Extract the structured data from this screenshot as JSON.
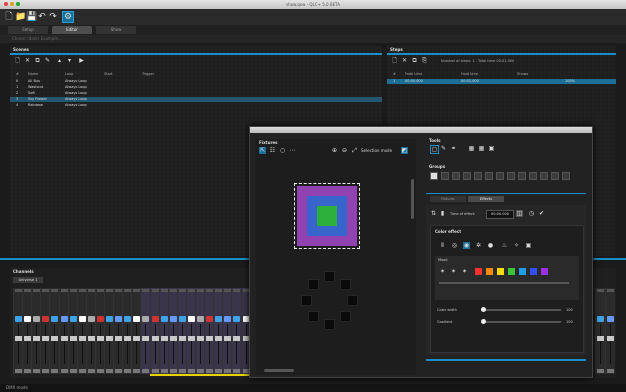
{
  "window": {
    "title": "show.qxw - QLC+ 5.0 BETA"
  },
  "tabs": [
    "Setup",
    "Editor",
    "Show"
  ],
  "subbar": {
    "text": "Chaser (dark) Example..."
  },
  "scenes": {
    "title": "Scenes",
    "columns": [
      "#",
      "Name",
      "Loop",
      "Start",
      "Trigger"
    ],
    "rows": [
      {
        "num": "0",
        "name": "All Bus",
        "loop": "Always Loop",
        "selected": false
      },
      {
        "num": "1",
        "name": "Washout",
        "loop": "Always Loop",
        "selected": false
      },
      {
        "num": "2",
        "name": "Soft",
        "loop": "Always Loop",
        "selected": false
      },
      {
        "num": "3",
        "name": "Sky Flower",
        "loop": "Always Loop",
        "selected": true
      },
      {
        "num": "4",
        "name": "Rainbow",
        "loop": "Always Loop",
        "selected": false
      }
    ]
  },
  "steps": {
    "title": "Steps",
    "info": "Number of steps: 1 - Total time 00:01.000",
    "columns": [
      "#",
      "Fade time",
      "Hold time",
      "Shows"
    ],
    "row": {
      "num": "1",
      "fade": "00:00.000",
      "hold": "00:01.000",
      "progress": "100%"
    }
  },
  "channels": {
    "title": "Channels",
    "tab": "Universe 1"
  },
  "status": {
    "text": "DMX mode"
  },
  "rgb": {
    "fixtures_title": "Fixtures",
    "selection_mode_label": "Selection mode",
    "tools_title": "Tools",
    "groups_title": "Groups",
    "tabs": [
      "Fixtures",
      "Effects"
    ],
    "time_of_effect_label": "Time of effect:",
    "time_value": "00:00.000",
    "color_effect_title": "Color effect",
    "mood_label": "Mood",
    "color_width_label": "Color width",
    "gradient_label": "Gradient",
    "color_width_value": "100",
    "gradient_value": "100",
    "swatch_colors": [
      "#ff3030",
      "#ff8a00",
      "#ffdb00",
      "#38c538",
      "#1e9ee6",
      "#3050ff",
      "#9c30e6"
    ],
    "accent_color": "#1a8fc7"
  }
}
